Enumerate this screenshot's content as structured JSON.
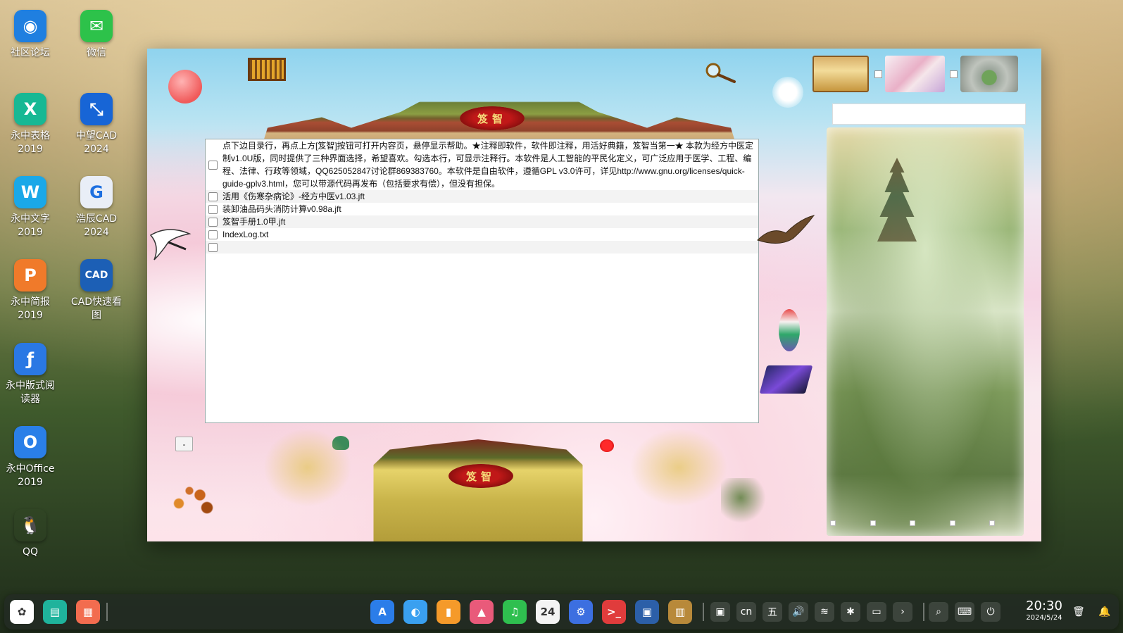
{
  "desktop": {
    "icons": [
      {
        "label": "社区论坛",
        "glyph": "◉",
        "color": "#1f7fe0"
      },
      {
        "label": "微信",
        "glyph": "✉",
        "color": "#2dc24a"
      },
      {
        "label": "永中表格\n2019",
        "glyph": "X",
        "color": "#17b894"
      },
      {
        "label": "中望CAD\n2024",
        "glyph": "⤡",
        "color": "#1765d6"
      },
      {
        "label": "永中文字\n2019",
        "glyph": "W",
        "color": "#1aa8e8"
      },
      {
        "label": "浩辰CAD\n2024",
        "glyph": "G",
        "color": "#e9eef7"
      },
      {
        "label": "永中简报\n2019",
        "glyph": "P",
        "color": "#f07a2a"
      },
      {
        "label": "CAD快速看\n图",
        "glyph": "CAD",
        "color": "#1c5fb5"
      },
      {
        "label": "永中版式阅\n读器",
        "glyph": "ƒ",
        "color": "#2a78e4"
      },
      {
        "label": "永中Office\n2019",
        "glyph": "O",
        "color": "#2a7fe8"
      },
      {
        "label": "QQ",
        "glyph": "🐧",
        "color": "transparent"
      }
    ]
  },
  "app": {
    "plaque_text": "笈智",
    "gate_plaque_text": "笈智",
    "list_items": [
      "点下边目录行，再点上方[笈智]按钮可打开内容页，悬停显示帮助。★注释即软件，软件即注释，用活好典籍，笈智当第一★ 本款为经方中医定制v1.0U版，同时提供了三种界面选择，希望喜欢。勾选本行，可显示注释行。本软件是人工智能的平民化定义，可广泛应用于医学、工程、编程、法律、行政等领域，QQ625052847讨论群869383760。本软件是自由软件，遵循GPL v3.0许可，详见http://www.gnu.org/licenses/quick-guide-gplv3.html，您可以带源代码再发布（包括要求有偿），但没有担保。",
      "活用《伤寒杂病论》-经方中医v1.03.jft",
      "装卸油品码头消防计算v0.98a.jft",
      "笈智手册1.0甲.jft",
      "IndexLog.txt",
      ""
    ],
    "minus_label": "-",
    "search_value": ""
  },
  "taskbar": {
    "apps": [
      {
        "name": "launcher",
        "glyph": "✿",
        "color": "#ffffff"
      },
      {
        "name": "multitask",
        "glyph": "▤",
        "color": "#1fb39c"
      },
      {
        "name": "workspace",
        "glyph": "▦",
        "color": "#f26c4f"
      },
      {
        "name": "app-store",
        "glyph": "A",
        "color": "#2b7de9"
      },
      {
        "name": "browser",
        "glyph": "◐",
        "color": "#3aa0f0"
      },
      {
        "name": "file-manager",
        "glyph": "▮",
        "color": "#f59a2a"
      },
      {
        "name": "photos",
        "glyph": "▲",
        "color": "#e95a7a"
      },
      {
        "name": "music",
        "glyph": "♫",
        "color": "#2fbf4f"
      },
      {
        "name": "calendar",
        "glyph": "24",
        "color": "#f4f4f4"
      },
      {
        "name": "settings",
        "glyph": "⚙",
        "color": "#3c6fe0"
      },
      {
        "name": "terminal",
        "glyph": ">_",
        "color": "#e03c3c"
      },
      {
        "name": "virtualbox",
        "glyph": "▣",
        "color": "#2c5fa8"
      },
      {
        "name": "jizhi-app",
        "glyph": "▥",
        "color": "#b8893a"
      }
    ],
    "tray": [
      "▣",
      "cn",
      "五",
      "🔊",
      "≋",
      "✱",
      "▭",
      "›",
      "⌕",
      "⌨",
      "⏻"
    ],
    "time": "20:30",
    "date": "2024/5/24"
  }
}
